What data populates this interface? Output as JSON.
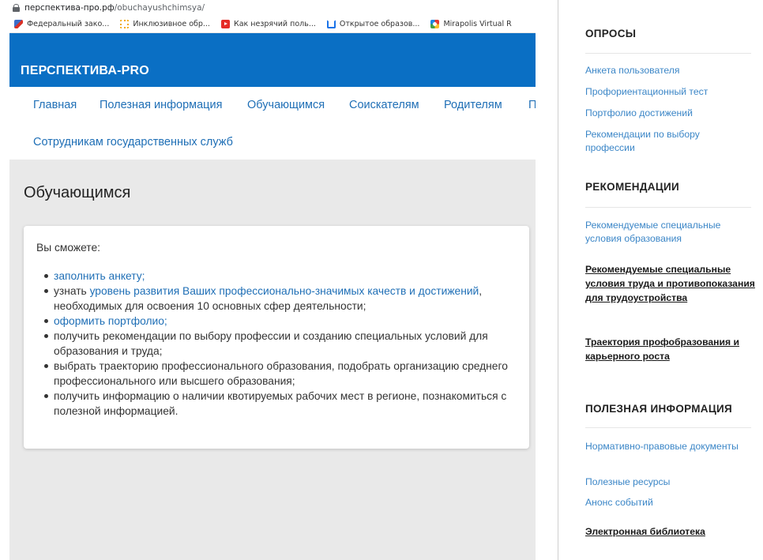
{
  "browser": {
    "url_domain": "перспектива-про.рф",
    "url_path": "/obuchayushchimsya/",
    "bookmarks": [
      {
        "label": "Федеральный зако...",
        "icon": "flag-icon"
      },
      {
        "label": "Инклюзивное обр...",
        "icon": "circle-dots-icon"
      },
      {
        "label": "Как незрячий поль...",
        "icon": "youtube-icon"
      },
      {
        "label": "Открытое образов...",
        "icon": "open-edu-icon"
      },
      {
        "label": "Mirapolis Virtual R",
        "icon": "mirapolis-icon"
      }
    ]
  },
  "site": {
    "brand": "ПЕРСПЕКТИВА-PRO",
    "brand_color": "#0a6fc4",
    "link_color": "#1f6fb6",
    "nav": [
      "Главная",
      "Полезная информация",
      "Обучающимся",
      "Соискателям",
      "Родителям",
      "П"
    ],
    "nav_row2": "Сотрудникам государственных служб"
  },
  "main": {
    "title": "Обучающимся",
    "intro": "Вы сможете:",
    "items": {
      "i1_link": "заполнить анкету;",
      "i2_pre": "узнать ",
      "i2_link": "уровень развития Ваших профессионально-значимых качеств и достижений",
      "i2_post": ", необходимых для освоения 10 основных сфер деятельности;",
      "i3_link": "оформить портфолио;",
      "i4": "получить рекомендации по выбору профессии и созданию специальных условий для образования и труда;",
      "i5": "выбрать траекторию профессионального образования, подобрать организацию среднего профессионального или высшего образования;",
      "i6": "получить информацию о наличии квотируемых рабочих мест в регионе, познакомиться с полезной информацией."
    }
  },
  "sidebar": {
    "surveys": {
      "title": "ОПРОСЫ",
      "links": [
        "Анкета пользователя",
        "Профориентационный тест",
        "Портфолио достижений",
        "Рекомендации по выбору профессии"
      ]
    },
    "recommendations": {
      "title": "РЕКОМЕНДАЦИИ",
      "link": "Рекомендуемые специальные условия образования",
      "bold1": "Рекомендуемые специальные условия труда и противопоказания для трудоустройства",
      "bold2": "Траектория профобразования и карьерного роста"
    },
    "useful": {
      "title": "ПОЛЕЗНАЯ ИНФОРМАЦИЯ",
      "links": [
        "Нормативно-правовые документы",
        "Полезные ресурсы",
        "Анонс событий"
      ],
      "bold": "Электронная библиотека"
    }
  }
}
